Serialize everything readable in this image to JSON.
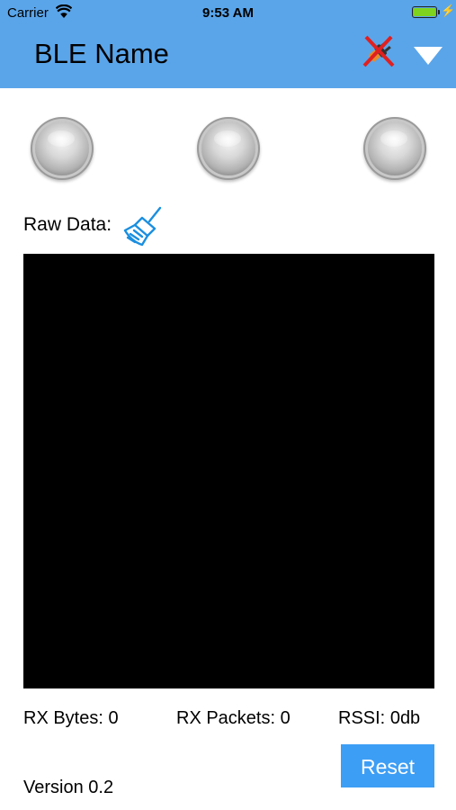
{
  "status_bar": {
    "carrier": "Carrier",
    "time": "9:53 AM",
    "battery_color": "#7ed321"
  },
  "header": {
    "title": "BLE Name",
    "background": "#5aa5ea",
    "connection_icon": "disconnected-plug-icon",
    "menu_icon": "triangle-down-icon"
  },
  "leds": [
    "led-1",
    "led-2",
    "led-3"
  ],
  "raw_data": {
    "label": "Raw Data:",
    "clear_icon": "broom-icon",
    "content": ""
  },
  "stats": {
    "rx_bytes_label": "RX Bytes:",
    "rx_bytes_value": "0",
    "rx_packets_label": "RX Packets:",
    "rx_packets_value": "0",
    "rssi_label": "RSSI:",
    "rssi_value": "0",
    "rssi_unit": "db"
  },
  "reset_button": {
    "label": "Reset",
    "color": "#3d9ef5"
  },
  "version": "Version 0.2"
}
